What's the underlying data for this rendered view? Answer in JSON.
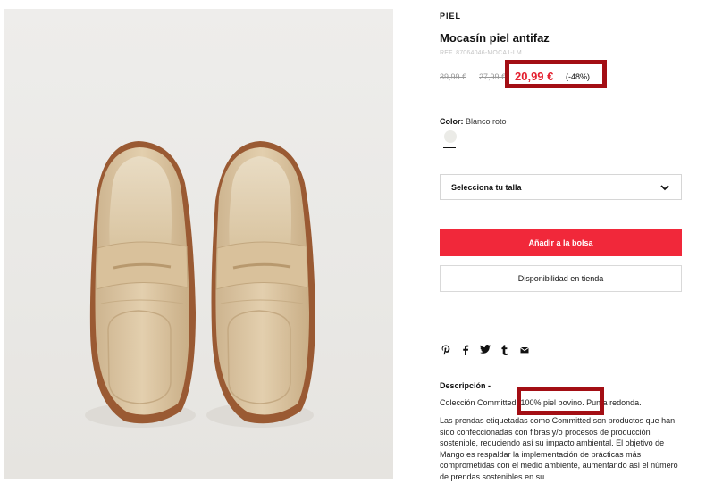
{
  "product": {
    "category": "PIEL",
    "title": "Mocasín piel antifaz",
    "ref": "REF. 87064046-MOCA1-LM",
    "price_original_1": "39,99 €",
    "price_original_2": "27,99 €",
    "price_current": "20,99 €",
    "discount": "(-48%)"
  },
  "color": {
    "label": "Color:",
    "value": "Blanco roto",
    "swatch_color": "#ebebe7"
  },
  "size_select": {
    "label": "Selecciona tu talla",
    "icon": "chevron-down-icon"
  },
  "buttons": {
    "add_to_bag": "Añadir a la bolsa",
    "store_availability": "Disponibilidad en tienda"
  },
  "share_icons": [
    "pinterest-icon",
    "facebook-icon",
    "twitter-icon",
    "tumblr-icon",
    "email-icon"
  ],
  "description": {
    "title": "Descripción -",
    "line1": "Colección Committed. 100% piel bovino. Punta redonda.",
    "line2": "Las prendas etiquetadas como Committed son productos que han sido confeccionadas con fibras y/o procesos de producción sostenible, reduciendo así su impacto ambiental. El objetivo de Mango es respaldar la implementación de prácticas más comprometidas con el medio ambiente, aumentando así el número de prendas sostenibles en su"
  },
  "colors": {
    "accent_red": "#f1283a",
    "price_red": "#e4202f",
    "highlight_border": "#a30e14"
  }
}
